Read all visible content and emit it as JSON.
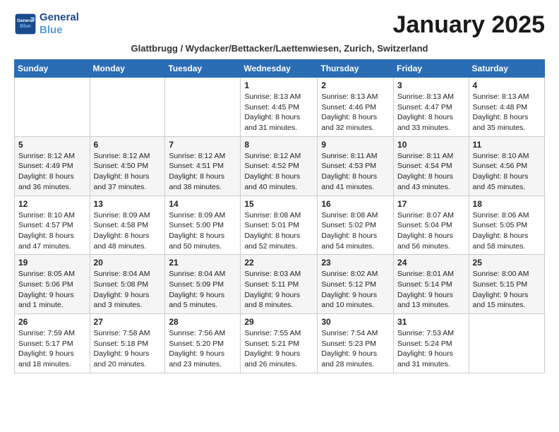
{
  "logo": {
    "line1": "General",
    "line2": "Blue"
  },
  "title": "January 2025",
  "subtitle": "Glattbrugg / Wydacker/Bettacker/Laettenwiesen, Zurich, Switzerland",
  "days_of_week": [
    "Sunday",
    "Monday",
    "Tuesday",
    "Wednesday",
    "Thursday",
    "Friday",
    "Saturday"
  ],
  "weeks": [
    [
      {
        "day": "",
        "info": ""
      },
      {
        "day": "",
        "info": ""
      },
      {
        "day": "",
        "info": ""
      },
      {
        "day": "1",
        "info": "Sunrise: 8:13 AM\nSunset: 4:45 PM\nDaylight: 8 hours and 31 minutes."
      },
      {
        "day": "2",
        "info": "Sunrise: 8:13 AM\nSunset: 4:46 PM\nDaylight: 8 hours and 32 minutes."
      },
      {
        "day": "3",
        "info": "Sunrise: 8:13 AM\nSunset: 4:47 PM\nDaylight: 8 hours and 33 minutes."
      },
      {
        "day": "4",
        "info": "Sunrise: 8:13 AM\nSunset: 4:48 PM\nDaylight: 8 hours and 35 minutes."
      }
    ],
    [
      {
        "day": "5",
        "info": "Sunrise: 8:12 AM\nSunset: 4:49 PM\nDaylight: 8 hours and 36 minutes."
      },
      {
        "day": "6",
        "info": "Sunrise: 8:12 AM\nSunset: 4:50 PM\nDaylight: 8 hours and 37 minutes."
      },
      {
        "day": "7",
        "info": "Sunrise: 8:12 AM\nSunset: 4:51 PM\nDaylight: 8 hours and 38 minutes."
      },
      {
        "day": "8",
        "info": "Sunrise: 8:12 AM\nSunset: 4:52 PM\nDaylight: 8 hours and 40 minutes."
      },
      {
        "day": "9",
        "info": "Sunrise: 8:11 AM\nSunset: 4:53 PM\nDaylight: 8 hours and 41 minutes."
      },
      {
        "day": "10",
        "info": "Sunrise: 8:11 AM\nSunset: 4:54 PM\nDaylight: 8 hours and 43 minutes."
      },
      {
        "day": "11",
        "info": "Sunrise: 8:10 AM\nSunset: 4:56 PM\nDaylight: 8 hours and 45 minutes."
      }
    ],
    [
      {
        "day": "12",
        "info": "Sunrise: 8:10 AM\nSunset: 4:57 PM\nDaylight: 8 hours and 47 minutes."
      },
      {
        "day": "13",
        "info": "Sunrise: 8:09 AM\nSunset: 4:58 PM\nDaylight: 8 hours and 48 minutes."
      },
      {
        "day": "14",
        "info": "Sunrise: 8:09 AM\nSunset: 5:00 PM\nDaylight: 8 hours and 50 minutes."
      },
      {
        "day": "15",
        "info": "Sunrise: 8:08 AM\nSunset: 5:01 PM\nDaylight: 8 hours and 52 minutes."
      },
      {
        "day": "16",
        "info": "Sunrise: 8:08 AM\nSunset: 5:02 PM\nDaylight: 8 hours and 54 minutes."
      },
      {
        "day": "17",
        "info": "Sunrise: 8:07 AM\nSunset: 5:04 PM\nDaylight: 8 hours and 56 minutes."
      },
      {
        "day": "18",
        "info": "Sunrise: 8:06 AM\nSunset: 5:05 PM\nDaylight: 8 hours and 58 minutes."
      }
    ],
    [
      {
        "day": "19",
        "info": "Sunrise: 8:05 AM\nSunset: 5:06 PM\nDaylight: 9 hours and 1 minute."
      },
      {
        "day": "20",
        "info": "Sunrise: 8:04 AM\nSunset: 5:08 PM\nDaylight: 9 hours and 3 minutes."
      },
      {
        "day": "21",
        "info": "Sunrise: 8:04 AM\nSunset: 5:09 PM\nDaylight: 9 hours and 5 minutes."
      },
      {
        "day": "22",
        "info": "Sunrise: 8:03 AM\nSunset: 5:11 PM\nDaylight: 9 hours and 8 minutes."
      },
      {
        "day": "23",
        "info": "Sunrise: 8:02 AM\nSunset: 5:12 PM\nDaylight: 9 hours and 10 minutes."
      },
      {
        "day": "24",
        "info": "Sunrise: 8:01 AM\nSunset: 5:14 PM\nDaylight: 9 hours and 13 minutes."
      },
      {
        "day": "25",
        "info": "Sunrise: 8:00 AM\nSunset: 5:15 PM\nDaylight: 9 hours and 15 minutes."
      }
    ],
    [
      {
        "day": "26",
        "info": "Sunrise: 7:59 AM\nSunset: 5:17 PM\nDaylight: 9 hours and 18 minutes."
      },
      {
        "day": "27",
        "info": "Sunrise: 7:58 AM\nSunset: 5:18 PM\nDaylight: 9 hours and 20 minutes."
      },
      {
        "day": "28",
        "info": "Sunrise: 7:56 AM\nSunset: 5:20 PM\nDaylight: 9 hours and 23 minutes."
      },
      {
        "day": "29",
        "info": "Sunrise: 7:55 AM\nSunset: 5:21 PM\nDaylight: 9 hours and 26 minutes."
      },
      {
        "day": "30",
        "info": "Sunrise: 7:54 AM\nSunset: 5:23 PM\nDaylight: 9 hours and 28 minutes."
      },
      {
        "day": "31",
        "info": "Sunrise: 7:53 AM\nSunset: 5:24 PM\nDaylight: 9 hours and 31 minutes."
      },
      {
        "day": "",
        "info": ""
      }
    ]
  ]
}
